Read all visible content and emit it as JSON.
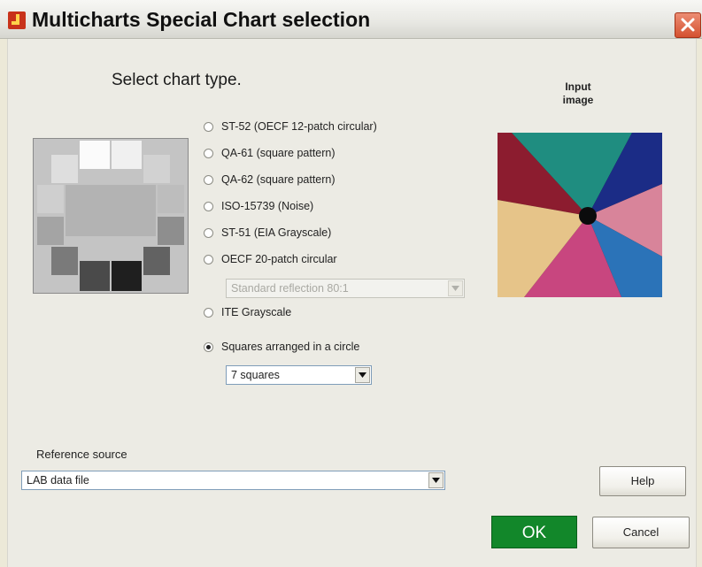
{
  "window": {
    "title": "Multicharts Special Chart selection"
  },
  "heading": "Select chart type.",
  "chart_types": [
    {
      "label": "ST-52 (OECF 12-patch circular)",
      "selected": false
    },
    {
      "label": "QA-61 (square pattern)",
      "selected": false
    },
    {
      "label": "QA-62 (square pattern)",
      "selected": false
    },
    {
      "label": "ISO-15739 (Noise)",
      "selected": false
    },
    {
      "label": "ST-51 (EIA Grayscale)",
      "selected": false
    },
    {
      "label": "OECF 20-patch circular",
      "selected": false
    },
    {
      "label": "ITE Grayscale",
      "selected": false
    },
    {
      "label": "Squares arranged in a circle",
      "selected": true
    }
  ],
  "oecf_dropdown": {
    "value": "Standard reflection 80:1",
    "enabled": false
  },
  "squares_dropdown": {
    "value": "7  squares"
  },
  "input_image_label": "Input\nimage",
  "reference": {
    "label": "Reference source",
    "value": "LAB data file"
  },
  "buttons": {
    "help": "Help",
    "ok": "OK",
    "cancel": "Cancel"
  },
  "colors": {
    "ok_button": "#12872a",
    "close_button": "#d4512f",
    "selection_border": "#7f9db9"
  }
}
